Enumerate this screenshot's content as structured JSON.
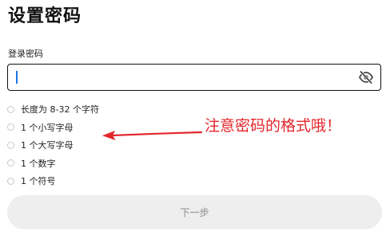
{
  "page": {
    "title": "设置密码"
  },
  "password_field": {
    "label": "登录密码",
    "value": "",
    "placeholder": "",
    "toggle_icon": "eye-off-icon"
  },
  "rules": [
    {
      "label": "长度为 8-32 个字符",
      "checked": false
    },
    {
      "label": "1 个小写字母",
      "checked": false
    },
    {
      "label": "1 个大写字母",
      "checked": false
    },
    {
      "label": "1 个数字",
      "checked": false
    },
    {
      "label": "1 个符号",
      "checked": false
    }
  ],
  "annotation": {
    "text": "注意密码的格式哦！",
    "color": "#e3262b"
  },
  "next_button": {
    "label": "下一步",
    "enabled": false
  }
}
